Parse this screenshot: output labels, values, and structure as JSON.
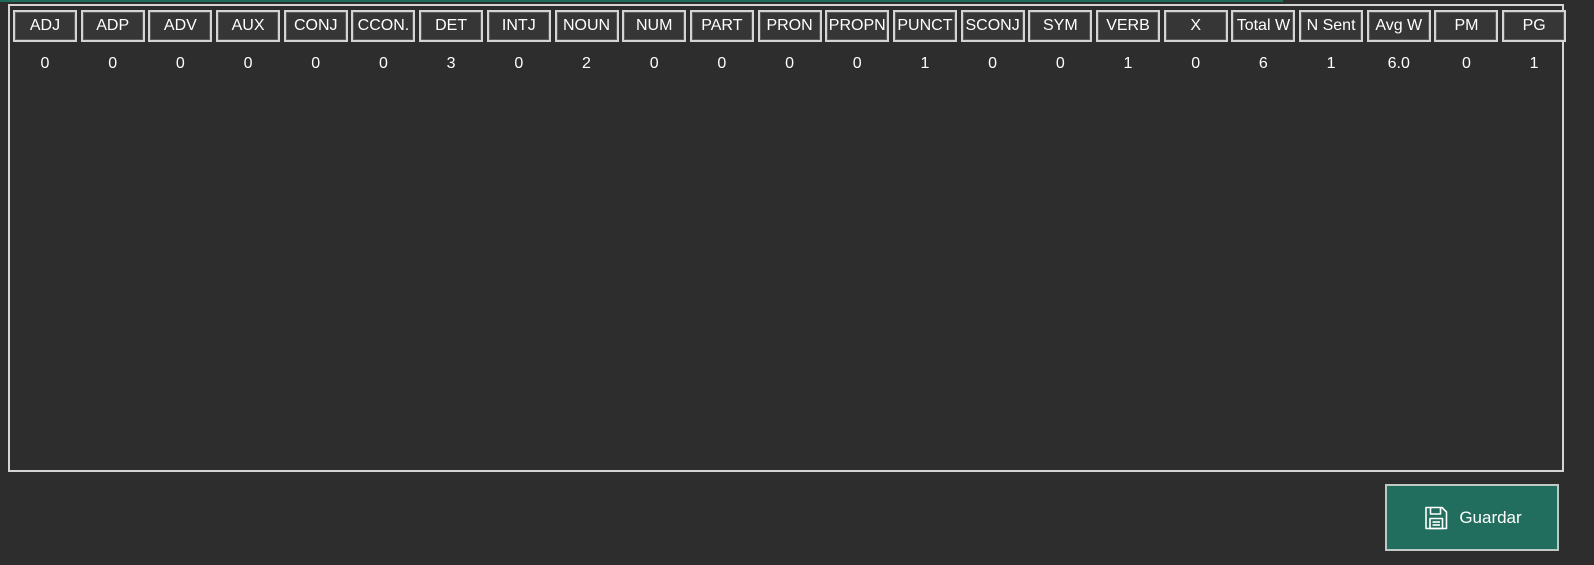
{
  "table": {
    "columns": [
      "ADJ",
      "ADP",
      "ADV",
      "AUX",
      "CONJ",
      "CCON.",
      "DET",
      "INTJ",
      "NOUN",
      "NUM",
      "PART",
      "PRON",
      "PROPN",
      "PUNCT",
      "SCONJ",
      "SYM",
      "VERB",
      "X",
      "Total W",
      "N Sent",
      "Avg W",
      "PM",
      "PG"
    ],
    "rows": [
      [
        "0",
        "0",
        "0",
        "0",
        "0",
        "0",
        "3",
        "0",
        "2",
        "0",
        "0",
        "0",
        "0",
        "1",
        "0",
        "0",
        "1",
        "0",
        "6",
        "1",
        "6.0",
        "0",
        "1"
      ]
    ]
  },
  "save_button": {
    "label": "Guardar",
    "icon": "save-icon"
  },
  "colors": {
    "background": "#2d2d2d",
    "accent": "#216e5e",
    "border": "#d4d4d4"
  }
}
